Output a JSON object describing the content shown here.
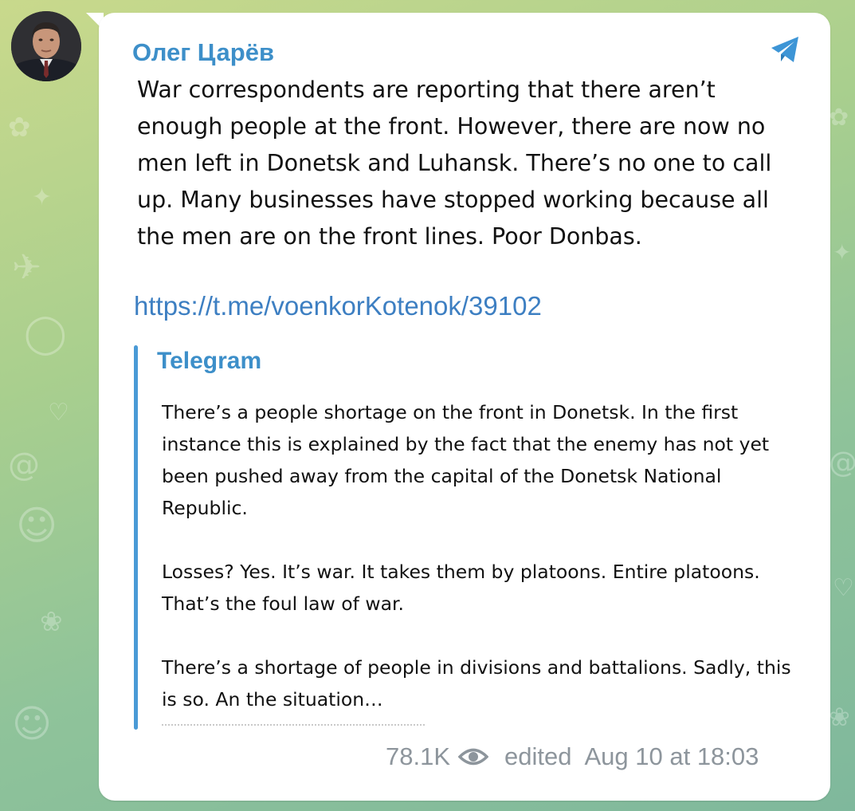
{
  "channel": {
    "name": "Олег Царёв",
    "avatar_icon": "channel-avatar",
    "platform_icon": "telegram-logo-icon",
    "accent": "#3d8fc9"
  },
  "post": {
    "text": "War correspondents are reporting that there aren’t enough people at the front. However, there are now no men left in Donetsk and Luhansk. There’s no one to call up. Many businesses have stopped working because all the men are on the front lines. Poor Donbas.",
    "link": "https://t.me/voenkorKotenok/39102"
  },
  "preview": {
    "site_name": "Telegram",
    "paragraphs": [
      "There’s a people shortage on the front in Donetsk. In the first instance this is explained by the fact that the enemy has not yet been pushed away from the capital of the Donetsk National Republic.",
      "Losses? Yes. It’s war. It takes them by platoons. Entire platoons. That’s the foul law of war.",
      "There’s a shortage of people in divisions and battalions. Sadly, this is so. An the situation…"
    ]
  },
  "meta": {
    "views": "78.1K",
    "views_icon": "eye-icon",
    "edited_label": "edited",
    "timestamp": "Aug 10 at 18:03"
  }
}
